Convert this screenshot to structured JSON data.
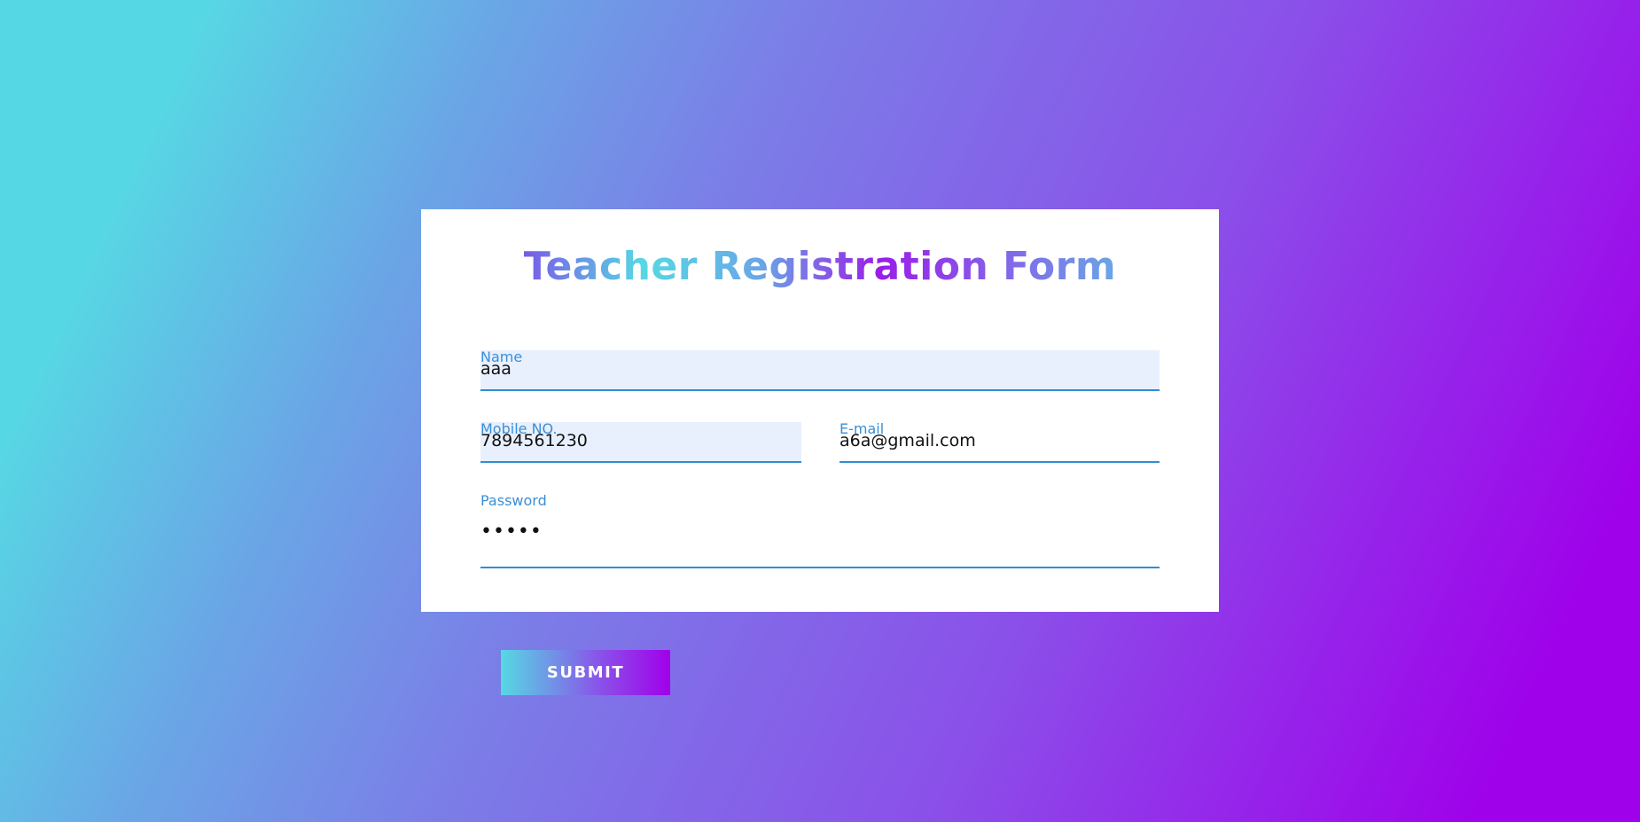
{
  "form": {
    "title": "Teacher Registration Form",
    "fields": {
      "name": {
        "label": "Name",
        "value": "aaa"
      },
      "mobile": {
        "label": "Mobile NO.",
        "value": "7894561230"
      },
      "email": {
        "label": "E-mail",
        "value": "a6a@gmail.com"
      },
      "password": {
        "label": "Password",
        "value": "•••••"
      }
    },
    "submit_label": "SUBMIT"
  },
  "colors": {
    "gradient_start": "#56d8e4",
    "gradient_end": "#9f01ea",
    "label": "#3a8fd6",
    "underline": "#2f8fd2",
    "autofill_bg": "#e8f0fe"
  }
}
